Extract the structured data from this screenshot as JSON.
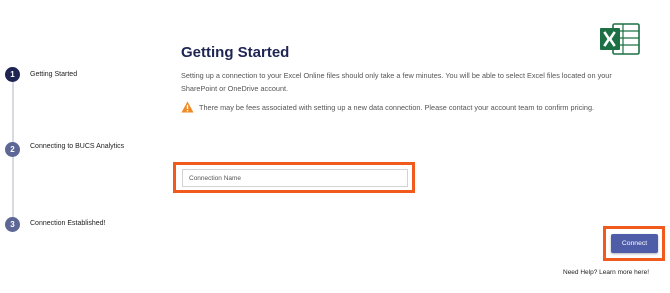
{
  "steps": [
    {
      "number": "1",
      "label": "Getting Started",
      "state": "active"
    },
    {
      "number": "2",
      "label": "Connecting to BUCS Analytics",
      "state": "pending"
    },
    {
      "number": "3",
      "label": "Connection Established!",
      "state": "pending"
    }
  ],
  "main": {
    "title": "Getting Started",
    "description": "Setting up a connection to your Excel Online files should only take a few minutes.  You will be able to select Excel files located on your SharePoint or OneDrive account.",
    "warning": "There may be fees associated with setting up a new data connection. Please contact your account team to confirm pricing."
  },
  "form": {
    "connection_name_placeholder": "Connection Name",
    "connection_name_value": ""
  },
  "actions": {
    "connect_label": "Connect",
    "help_label": "Need Help? Learn more here!"
  },
  "icons": {
    "app_logo": "excel-logo-icon",
    "warning": "warning-triangle-icon"
  },
  "colors": {
    "primary": "#1f2553",
    "step_pending": "#5d6795",
    "button": "#4f5da8",
    "highlight": "#f05a1c",
    "warning": "#f08a24",
    "excel_green": "#1d7044"
  }
}
